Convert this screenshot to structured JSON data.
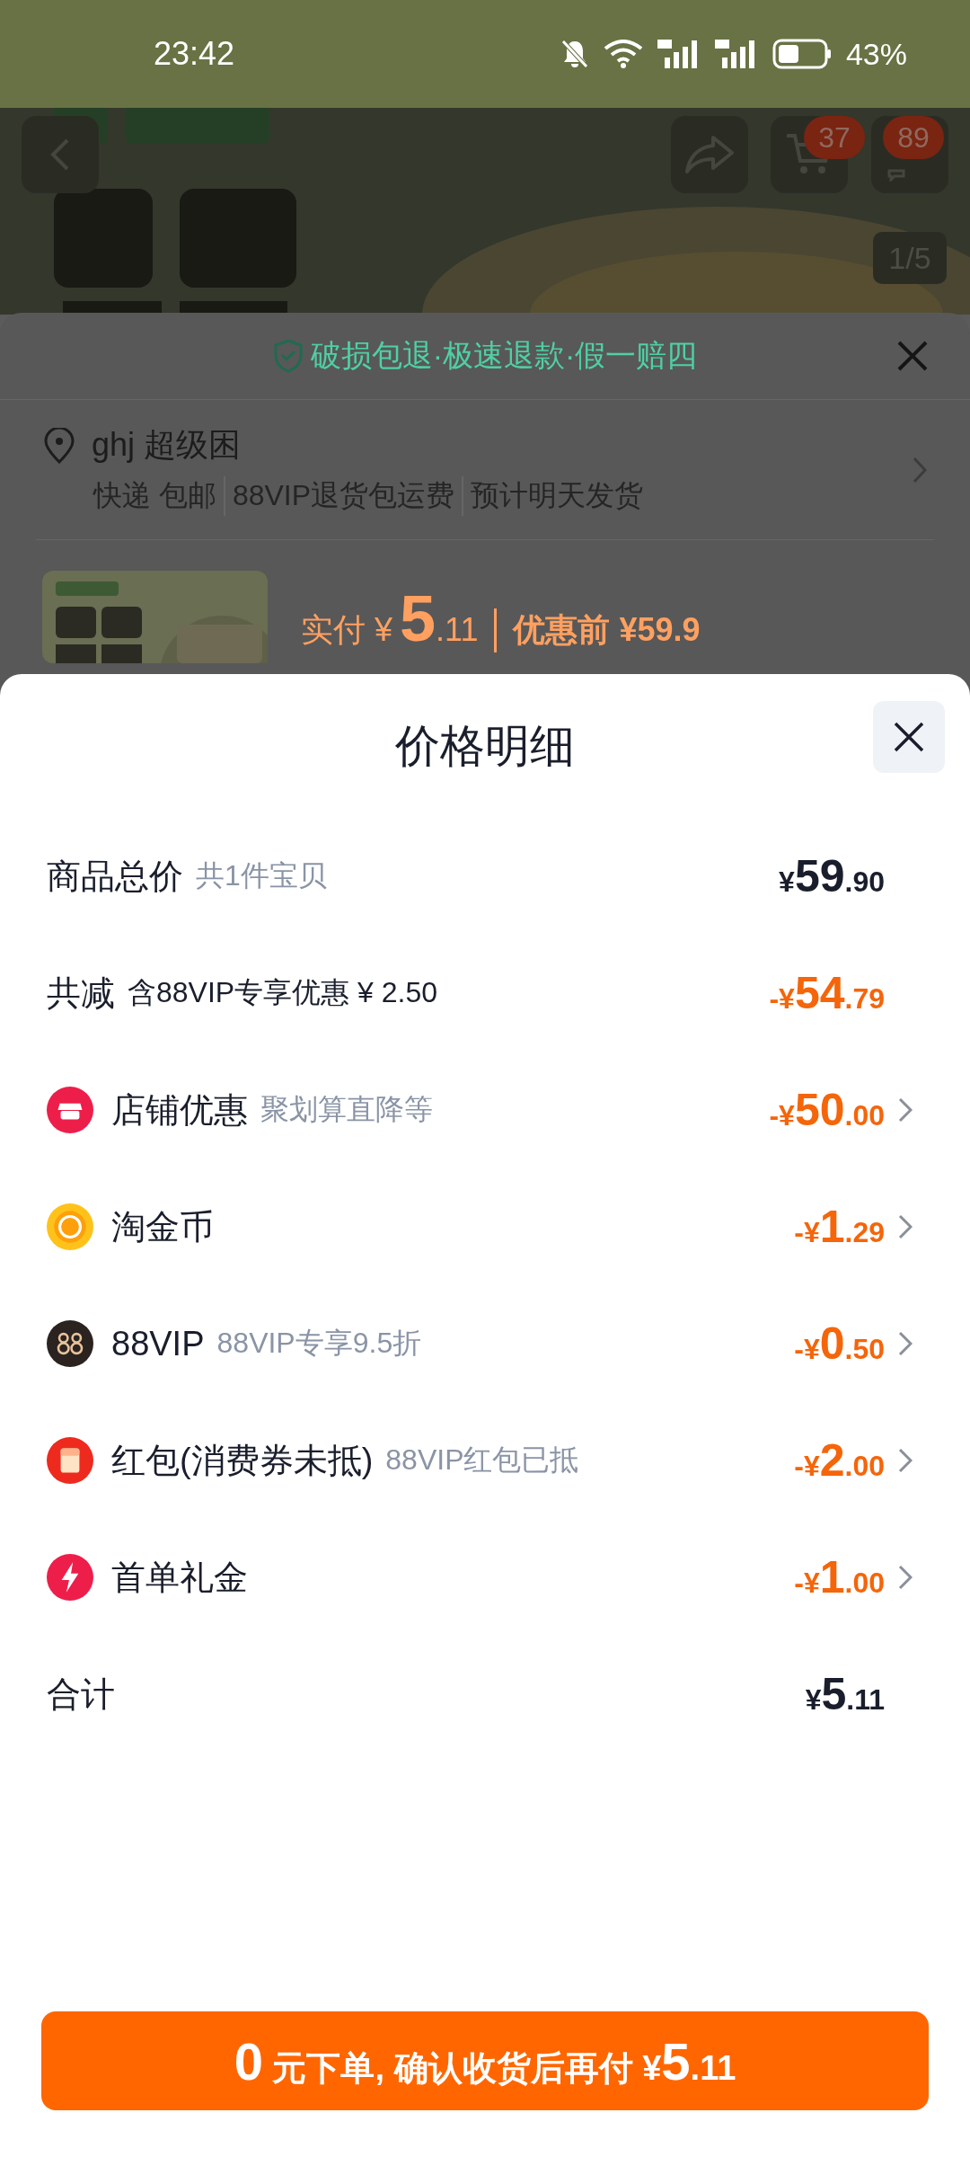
{
  "status_bar": {
    "time": "23:42",
    "battery": "43%"
  },
  "product_header": {
    "cart_badge": "37",
    "message_badge": "89",
    "page_indicator": "1/5"
  },
  "order_sheet": {
    "guarantee": "破损包退·极速退款·假一赔四",
    "address": "ghj 超级困",
    "shipping": [
      "快递 包邮",
      "88VIP退货包运费",
      "预计明天发货"
    ],
    "paid_price": "实付 ¥**5**.11",
    "original_price": "优惠前 ¥59.9"
  },
  "price_detail": {
    "title": "价格明细",
    "rows": [
      {
        "kind": "summary",
        "label": "商品总价",
        "note": "共1件宝贝",
        "amount": "¥**59**.90",
        "negative": false
      },
      {
        "kind": "summary",
        "label": "共减",
        "note": "含88VIP专享优惠 ¥ 2.50",
        "amount": "-¥**54**.79",
        "negative": true
      },
      {
        "kind": "item",
        "label": "店铺优惠",
        "note": "聚划算直降等",
        "amount": "-¥**50**.00",
        "negative": true
      },
      {
        "kind": "item",
        "label": "淘金币",
        "amount": "-¥**1**.29",
        "negative": true
      },
      {
        "kind": "item",
        "label": "88VIP",
        "note": "88VIP专享9.5折",
        "amount": "-¥**0**.50",
        "negative": true
      },
      {
        "kind": "item",
        "label": "红包(消费券未抵)",
        "note": "88VIP红包已抵",
        "amount": "-¥**2**.00",
        "negative": true
      },
      {
        "kind": "item",
        "label": "首单礼金",
        "amount": "-¥**1**.00",
        "negative": true
      },
      {
        "kind": "summary",
        "label": "合计",
        "amount": "¥**5**.11",
        "negative": false
      }
    ],
    "pay_button": "**0** 元下单, 确认收货后再付 ¥**5**.11"
  }
}
